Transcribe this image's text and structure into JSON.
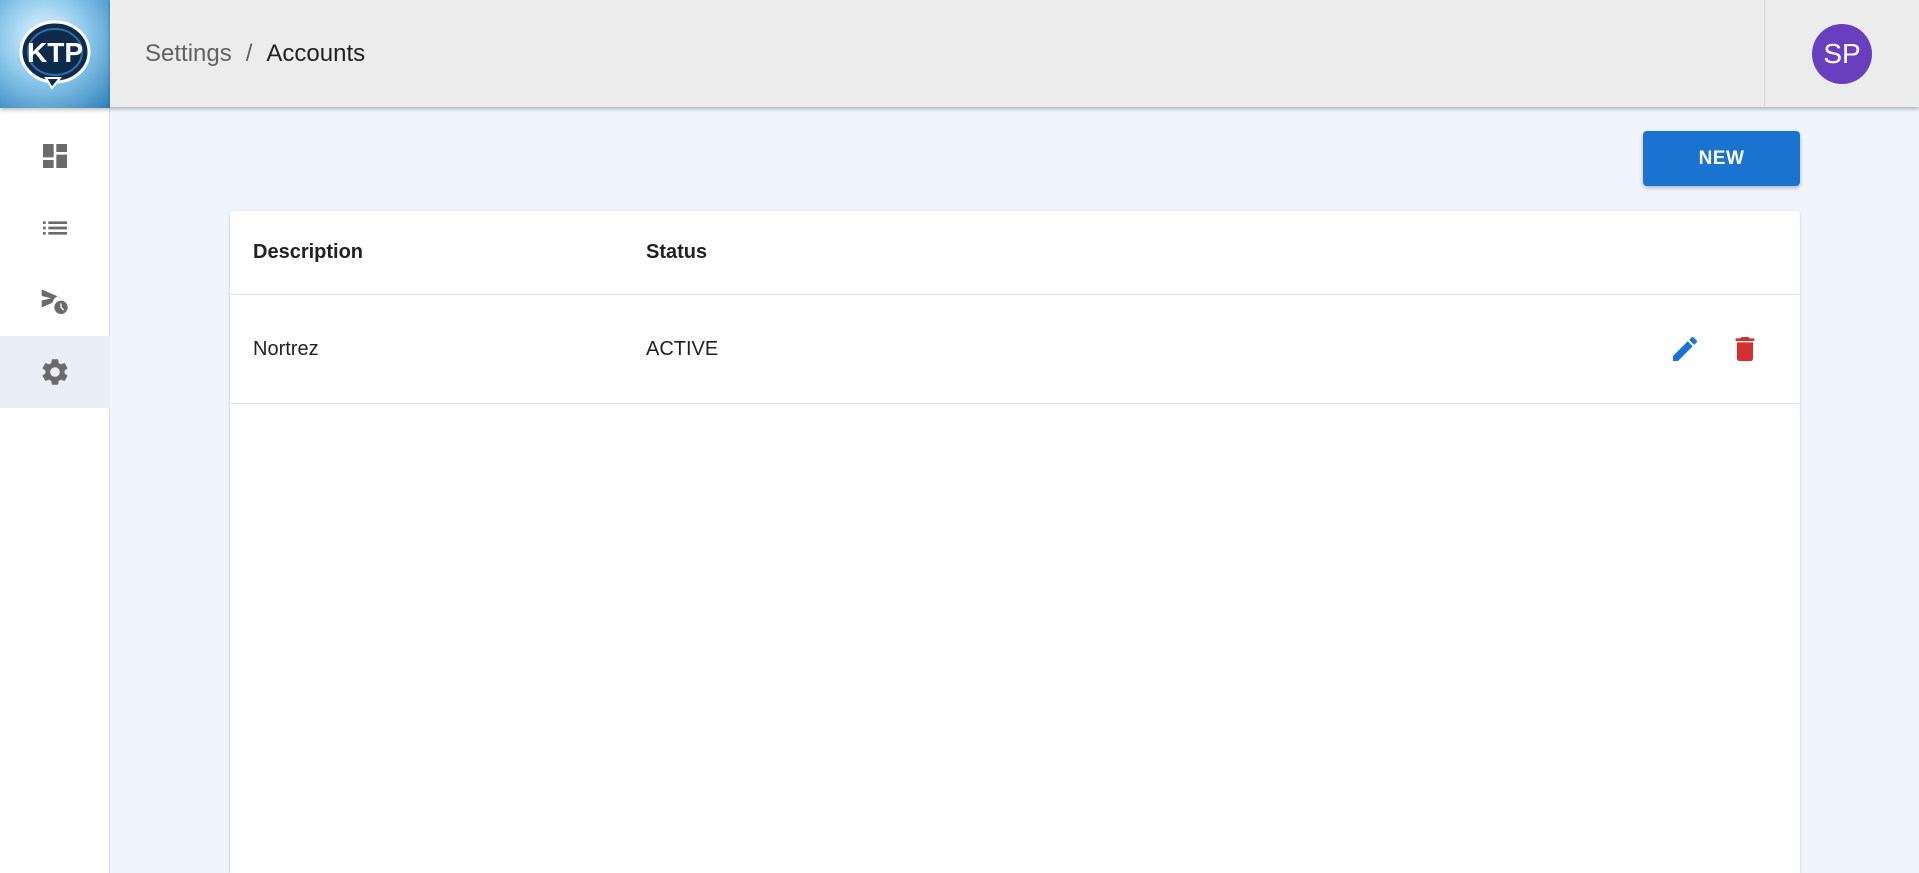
{
  "app": {
    "logo_text": "KTP"
  },
  "sidebar": {
    "items": [
      {
        "icon": "dashboard-icon",
        "active": false
      },
      {
        "icon": "list-icon",
        "active": false
      },
      {
        "icon": "scheduled-send-icon",
        "active": false
      },
      {
        "icon": "gear-icon",
        "active": true
      }
    ]
  },
  "header": {
    "breadcrumb": {
      "parent": "Settings",
      "separator": "/",
      "current": "Accounts"
    },
    "avatar_initials": "SP",
    "avatar_color": "#6a3fbf"
  },
  "toolbar": {
    "new_label": "NEW",
    "accent": "#1a73d1"
  },
  "table": {
    "columns": [
      "Description",
      "Status"
    ],
    "rows": [
      {
        "description": "Nortrez",
        "status": "ACTIVE"
      }
    ],
    "edit_color": "#1a73d1",
    "delete_color": "#d32f2f"
  }
}
